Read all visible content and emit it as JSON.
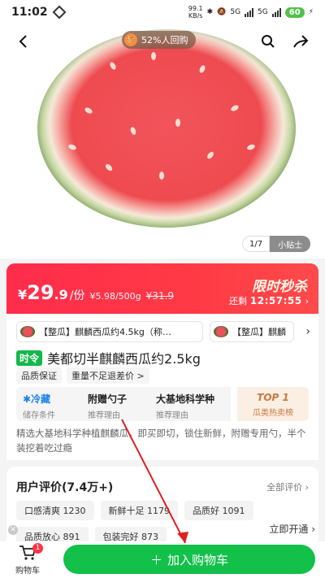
{
  "status_bar": {
    "time": "11:02",
    "net_speed_value": "99.1",
    "net_speed_unit": "KB/s",
    "network_a": "5G",
    "network_b": "5G",
    "battery": "60"
  },
  "hero": {
    "repurchase_badge": "52%人回购",
    "pager": "1/7",
    "tip_label": "小贴士"
  },
  "price_banner": {
    "currency": "¥",
    "price_int": "29",
    "price_dec": ".9",
    "unit": "/份",
    "per_weight": "¥5.98/500g",
    "original_price": "¥31.9",
    "flash_sale_label": "限时秒杀",
    "remaining_label": "还剩",
    "countdown": "12:57:55"
  },
  "packages": [
    {
      "label": "【整瓜】麒麟西瓜约4.5kg（称…"
    },
    {
      "label": "【整瓜】麒麟"
    }
  ],
  "product": {
    "season_tag": "时令",
    "title": "美都切半麒麟西瓜约2.5kg",
    "guarantees": [
      "品质保证",
      "重量不足退差价 >"
    ],
    "tiles": [
      {
        "title": "冷藏",
        "sub": "储存条件"
      },
      {
        "title": "附赠勺子",
        "sub": "推荐理由"
      },
      {
        "title": "大基地科学种",
        "sub": "推荐理由"
      },
      {
        "title": "TOP 1",
        "sub": "瓜类热卖榜"
      }
    ],
    "description": "精选大基地科学种植麒麟瓜，即买即切，锁住新鲜，附赠专用勺，半个装挖着吃过瘾"
  },
  "reviews": {
    "title": "用户评价(7.4万+)",
    "all_label": "全部评价",
    "chips": [
      {
        "label": "口感清爽 1230"
      },
      {
        "label": "新鲜十足 1179"
      },
      {
        "label": "品质好 1091"
      },
      {
        "label": "品质放心 891"
      },
      {
        "label": "包装完好 873"
      }
    ]
  },
  "bottom_bar": {
    "cart_label": "购物车",
    "cart_count": "1",
    "open_now_label": "立即开通",
    "add_to_cart_label": "加入购物车"
  },
  "colors": {
    "accent_green": "#12c04a",
    "sale_red": "#ff2c4c",
    "top_badge": "#c8793d"
  }
}
